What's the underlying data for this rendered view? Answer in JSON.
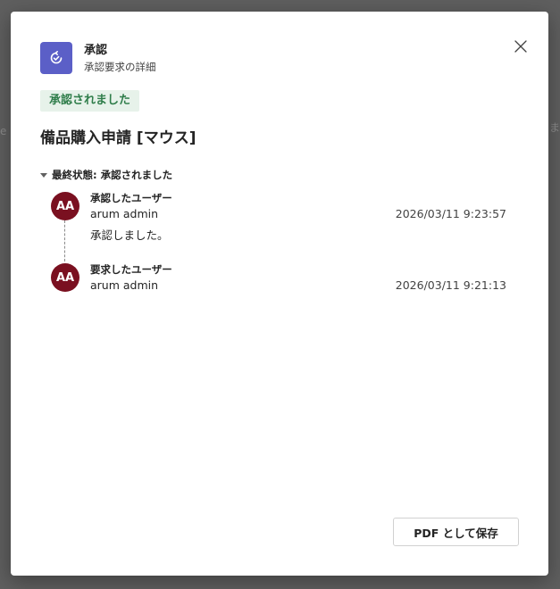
{
  "background": {
    "left_hint": "e",
    "right_hint": "ま"
  },
  "dialog": {
    "app": {
      "icon": "approvals-icon",
      "title": "承認",
      "subtitle": "承認要求の詳細",
      "accent": "#5b5fc7"
    },
    "close_icon": "close-icon",
    "status_badge": "承認されました",
    "request_title": "備品購入申請 [マウス]",
    "final_state_label": "最終状態: 承認されました",
    "timeline": [
      {
        "avatar": "AA",
        "role": "承認したユーザー",
        "name": "arum admin",
        "timestamp": "2026/03/11 9:23:57",
        "comment": "承認しました。"
      },
      {
        "avatar": "AA",
        "role": "要求したユーザー",
        "name": "arum admin",
        "timestamp": "2026/03/11 9:21:13"
      }
    ],
    "save_pdf_label": "PDF として保存",
    "colors": {
      "badge_bg": "#e7f2ea",
      "badge_text": "#2f7d4a",
      "avatar_bg": "#7a1020"
    }
  }
}
